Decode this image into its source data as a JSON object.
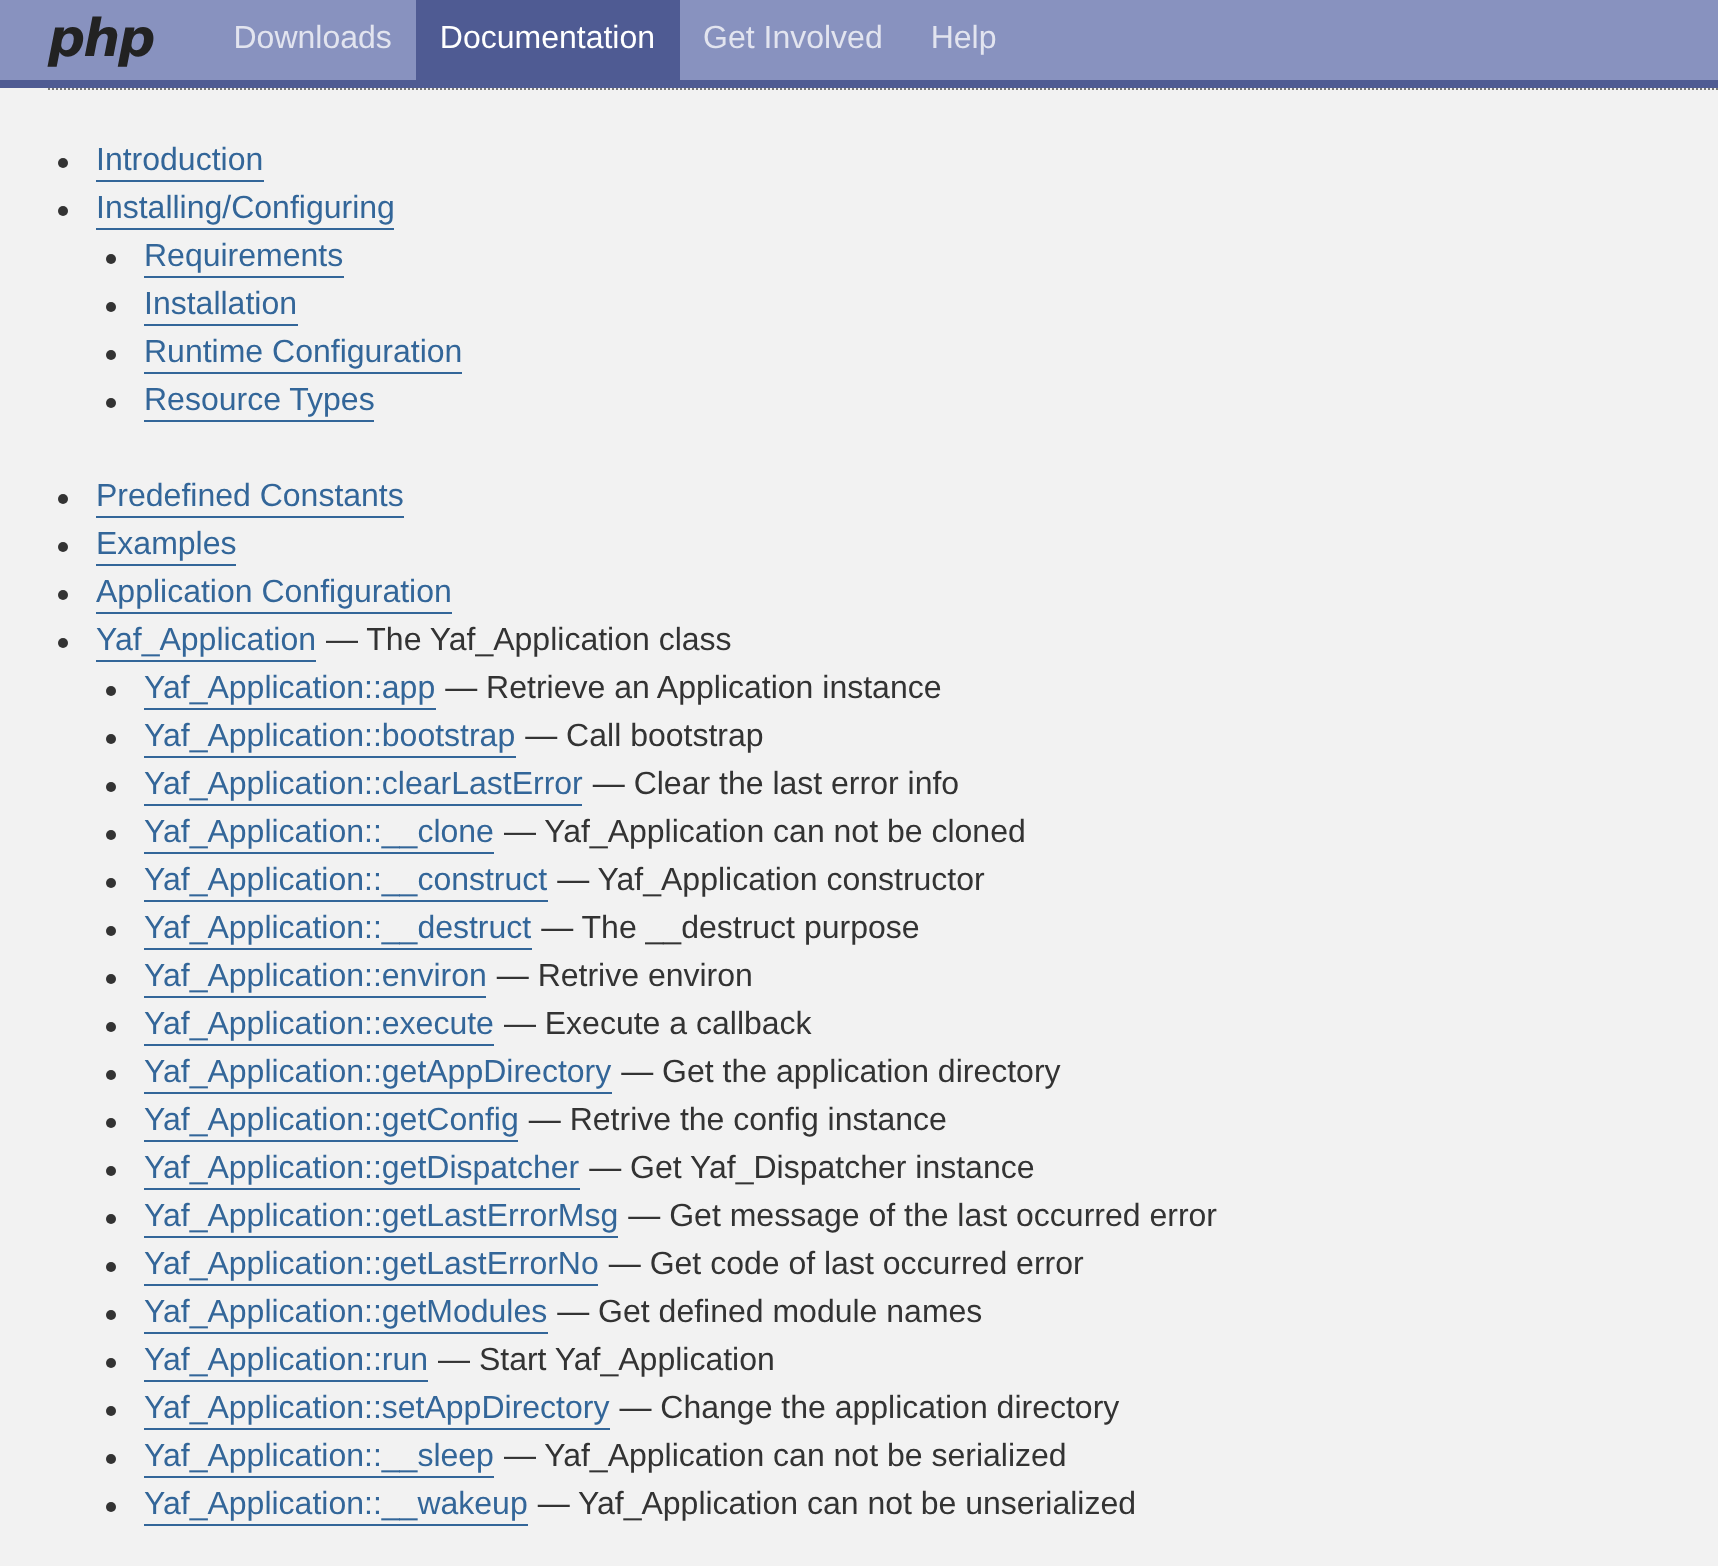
{
  "logo": "php",
  "nav": [
    {
      "label": "Downloads",
      "selected": false
    },
    {
      "label": "Documentation",
      "selected": true
    },
    {
      "label": "Get Involved",
      "selected": false
    },
    {
      "label": "Help",
      "selected": false
    }
  ],
  "toc": [
    {
      "title": "Introduction"
    },
    {
      "title": "Installing/Configuring",
      "children": [
        {
          "title": "Requirements"
        },
        {
          "title": "Installation"
        },
        {
          "title": "Runtime Configuration"
        },
        {
          "title": "Resource Types"
        }
      ]
    },
    {
      "title": "Predefined Constants"
    },
    {
      "title": "Examples"
    },
    {
      "title": "Application Configuration"
    },
    {
      "title": "Yaf_Application",
      "description": "— The Yaf_Application class",
      "children": [
        {
          "title": "Yaf_Application::app",
          "description": "— Retrieve an Application instance"
        },
        {
          "title": "Yaf_Application::bootstrap",
          "description": "— Call bootstrap"
        },
        {
          "title": "Yaf_Application::clearLastError",
          "description": "— Clear the last error info"
        },
        {
          "title": "Yaf_Application::__clone",
          "description": "— Yaf_Application can not be cloned"
        },
        {
          "title": "Yaf_Application::__construct",
          "description": "— Yaf_Application constructor"
        },
        {
          "title": "Yaf_Application::__destruct",
          "description": "— The __destruct purpose"
        },
        {
          "title": "Yaf_Application::environ",
          "description": "— Retrive environ"
        },
        {
          "title": "Yaf_Application::execute",
          "description": "— Execute a callback"
        },
        {
          "title": "Yaf_Application::getAppDirectory",
          "description": "— Get the application directory"
        },
        {
          "title": "Yaf_Application::getConfig",
          "description": "— Retrive the config instance"
        },
        {
          "title": "Yaf_Application::getDispatcher",
          "description": "— Get Yaf_Dispatcher instance"
        },
        {
          "title": "Yaf_Application::getLastErrorMsg",
          "description": "— Get message of the last occurred error"
        },
        {
          "title": "Yaf_Application::getLastErrorNo",
          "description": "— Get code of last occurred error"
        },
        {
          "title": "Yaf_Application::getModules",
          "description": "— Get defined module names"
        },
        {
          "title": "Yaf_Application::run",
          "description": "— Start Yaf_Application"
        },
        {
          "title": "Yaf_Application::setAppDirectory",
          "description": "— Change the application directory"
        },
        {
          "title": "Yaf_Application::__sleep",
          "description": "— Yaf_Application can not be serialized"
        },
        {
          "title": "Yaf_Application::__wakeup",
          "description": "— Yaf_Application can not be unserialized"
        }
      ]
    }
  ]
}
